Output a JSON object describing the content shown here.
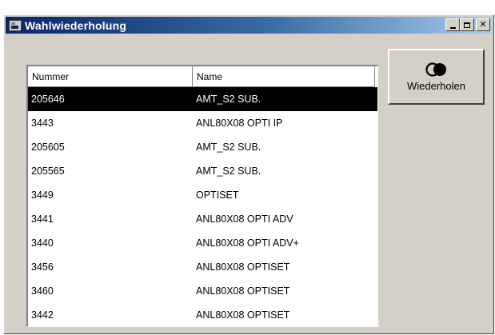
{
  "window": {
    "title": "Wahlwiederholung"
  },
  "list": {
    "columns": [
      "Nummer",
      "Name"
    ],
    "rows": [
      {
        "number": "205646",
        "name": "AMT_S2 SUB.",
        "selected": true
      },
      {
        "number": "3443",
        "name": "ANL80X08 OPTI IP"
      },
      {
        "number": "205605",
        "name": "AMT_S2 SUB."
      },
      {
        "number": "205565",
        "name": "AMT_S2 SUB."
      },
      {
        "number": "3449",
        "name": "OPTISET"
      },
      {
        "number": "3441",
        "name": "ANL80X08 OPTI ADV"
      },
      {
        "number": "3440",
        "name": "ANL80X08 OPTI ADV+"
      },
      {
        "number": "3456",
        "name": "ANL80X08 OPTISET"
      },
      {
        "number": "3460",
        "name": "ANL80X08 OPTISET"
      },
      {
        "number": "3442",
        "name": "ANL80X08 OPTISET"
      }
    ]
  },
  "repeat_button": {
    "label": "Wiederholen",
    "icon": "redial-icon"
  },
  "colors": {
    "title_gradient_start": "#0a246a",
    "title_gradient_end": "#a6caf0",
    "window_face": "#d4d0c8",
    "selection": "#000000"
  }
}
